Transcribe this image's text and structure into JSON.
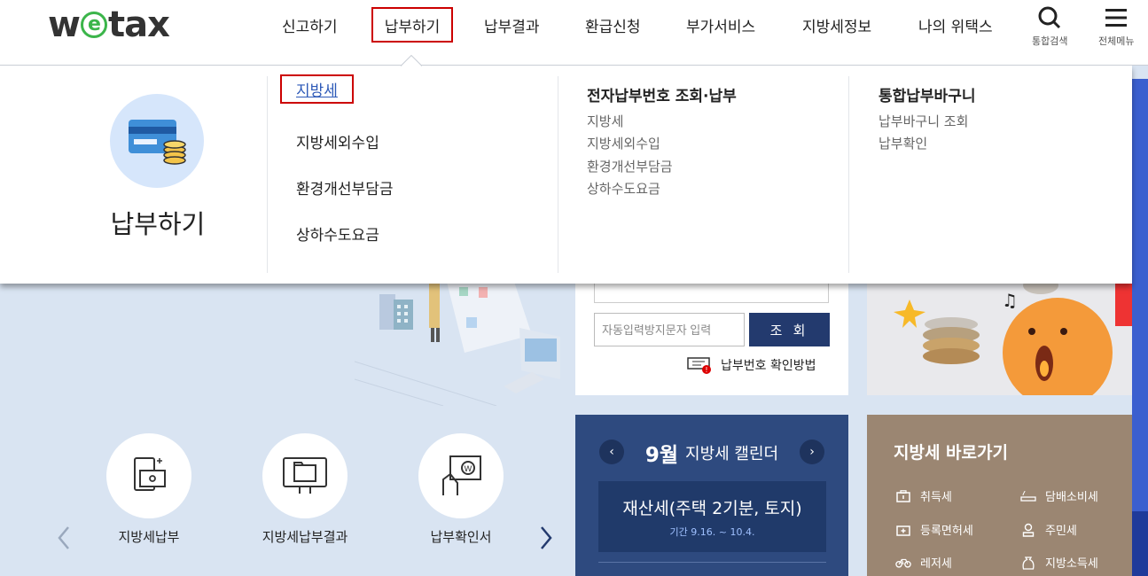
{
  "header": {
    "logo": {
      "pre": "w",
      "e": "e",
      "post": "tax"
    },
    "nav": [
      {
        "label": "신고하기"
      },
      {
        "label": "납부하기"
      },
      {
        "label": "납부결과"
      },
      {
        "label": "환급신청"
      },
      {
        "label": "부가서비스"
      },
      {
        "label": "지방세정보"
      },
      {
        "label": "나의 위택스"
      }
    ],
    "search_label": "통합검색",
    "menu_label": "전체메뉴"
  },
  "mega": {
    "title": "납부하기",
    "col1": [
      "지방세",
      "지방세외수입",
      "환경개선부담금",
      "상하수도요금"
    ],
    "col2": {
      "heading": "전자납부번호 조회·납부",
      "items": [
        "지방세",
        "지방세외수입",
        "환경개선부담금",
        "상하수도요금"
      ]
    },
    "col3": {
      "heading": "통합납부바구니",
      "items": [
        "납부바구니 조회",
        "납부확인"
      ]
    }
  },
  "search_card": {
    "captcha_placeholder": "자동입력방지문자 입력",
    "search_button": "조 회",
    "how_link": "납부번호 확인방법"
  },
  "calendar": {
    "month": "9월",
    "title": "지방세 캘린더",
    "event": "재산세(주택 2기분, 토지)",
    "period": "기간 9.16. ~ 10.4.",
    "prev": "‹",
    "next": "›"
  },
  "shortcut": {
    "title": "지방세 바로가기",
    "items": [
      "취득세",
      "담배소비세",
      "등록면허세",
      "주민세",
      "레저세",
      "지방소득세"
    ]
  },
  "quick": [
    "지방세납부",
    "지방세납부결과",
    "납부확인서"
  ],
  "colors": {
    "navy": "#233a6e",
    "calendar": "#2e4a7f",
    "shortcut": "#9b8672",
    "active_border": "#cc0000",
    "logo_green": "#3bb54a"
  }
}
